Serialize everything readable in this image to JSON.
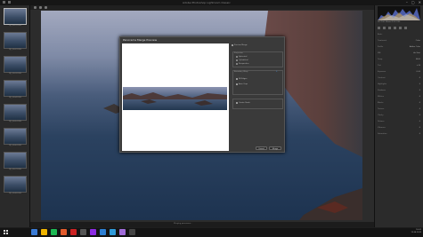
{
  "window": {
    "title": "Adobe Photoshop Lightroom Classic",
    "controls": [
      "–",
      "▢",
      "✕"
    ]
  },
  "filmstrip": {
    "thumbnails": [
      {
        "caption": "DJI_0001.DNG",
        "selected": true
      },
      {
        "caption": "DJI_0002.DNG",
        "selected": false
      },
      {
        "caption": "DJI_0003.DNG",
        "selected": false
      },
      {
        "caption": "DJI_0004.DNG",
        "selected": false
      },
      {
        "caption": "DJI_0005.DNG",
        "selected": false
      },
      {
        "caption": "DJI_0006.DNG",
        "selected": false
      },
      {
        "caption": "DJI_0007.DNG",
        "selected": false
      },
      {
        "caption": "DJI_0008.DNG",
        "selected": false
      }
    ]
  },
  "dialog": {
    "title": "Panorama Merge Preview",
    "options_top": "Preview Merge",
    "projection_label": "Projection",
    "projections": [
      "Spherical",
      "Cylindrical",
      "Perspective"
    ],
    "selected_projection": "Cylindrical",
    "boundary_warp_label": "Boundary Warp",
    "boundary_warp_value": "0",
    "fill_edges": "Fill Edges",
    "auto_crop": "Auto Crop",
    "create_stack_label": "Create Stack",
    "merge_label": "Merge",
    "cancel_label": "Cancel"
  },
  "right_panel": {
    "meta": "ISO 100  24mm  f/2.8  1/50",
    "rows": [
      {
        "label": "Basic",
        "value": ""
      },
      {
        "label": "Treatment",
        "value": "Color"
      },
      {
        "label": "Profile",
        "value": "Adobe Color"
      },
      {
        "label": "WB",
        "value": "As Shot"
      },
      {
        "label": "Temp",
        "value": "5400"
      },
      {
        "label": "Tint",
        "value": "+10"
      },
      {
        "label": "Exposure",
        "value": "0.00"
      },
      {
        "label": "Contrast",
        "value": "0"
      },
      {
        "label": "Highlights",
        "value": "0"
      },
      {
        "label": "Shadows",
        "value": "0"
      },
      {
        "label": "Whites",
        "value": "0"
      },
      {
        "label": "Blacks",
        "value": "0"
      },
      {
        "label": "Texture",
        "value": "0"
      },
      {
        "label": "Clarity",
        "value": "0"
      },
      {
        "label": "Dehaze",
        "value": "0"
      },
      {
        "label": "Vibrance",
        "value": "0"
      },
      {
        "label": "Saturation",
        "value": "0"
      }
    ]
  },
  "status": {
    "text": "Merging panorama…"
  },
  "taskbar": {
    "time": "16:02",
    "date": "12.04.2020",
    "icon_colors": [
      "#3a7bd5",
      "#f0b400",
      "#1db954",
      "#e25b2c",
      "#cc2222",
      "#555",
      "#8b2be2",
      "#2d7fd3",
      "#2f9ad8",
      "#9f6bd8",
      "#444"
    ]
  }
}
